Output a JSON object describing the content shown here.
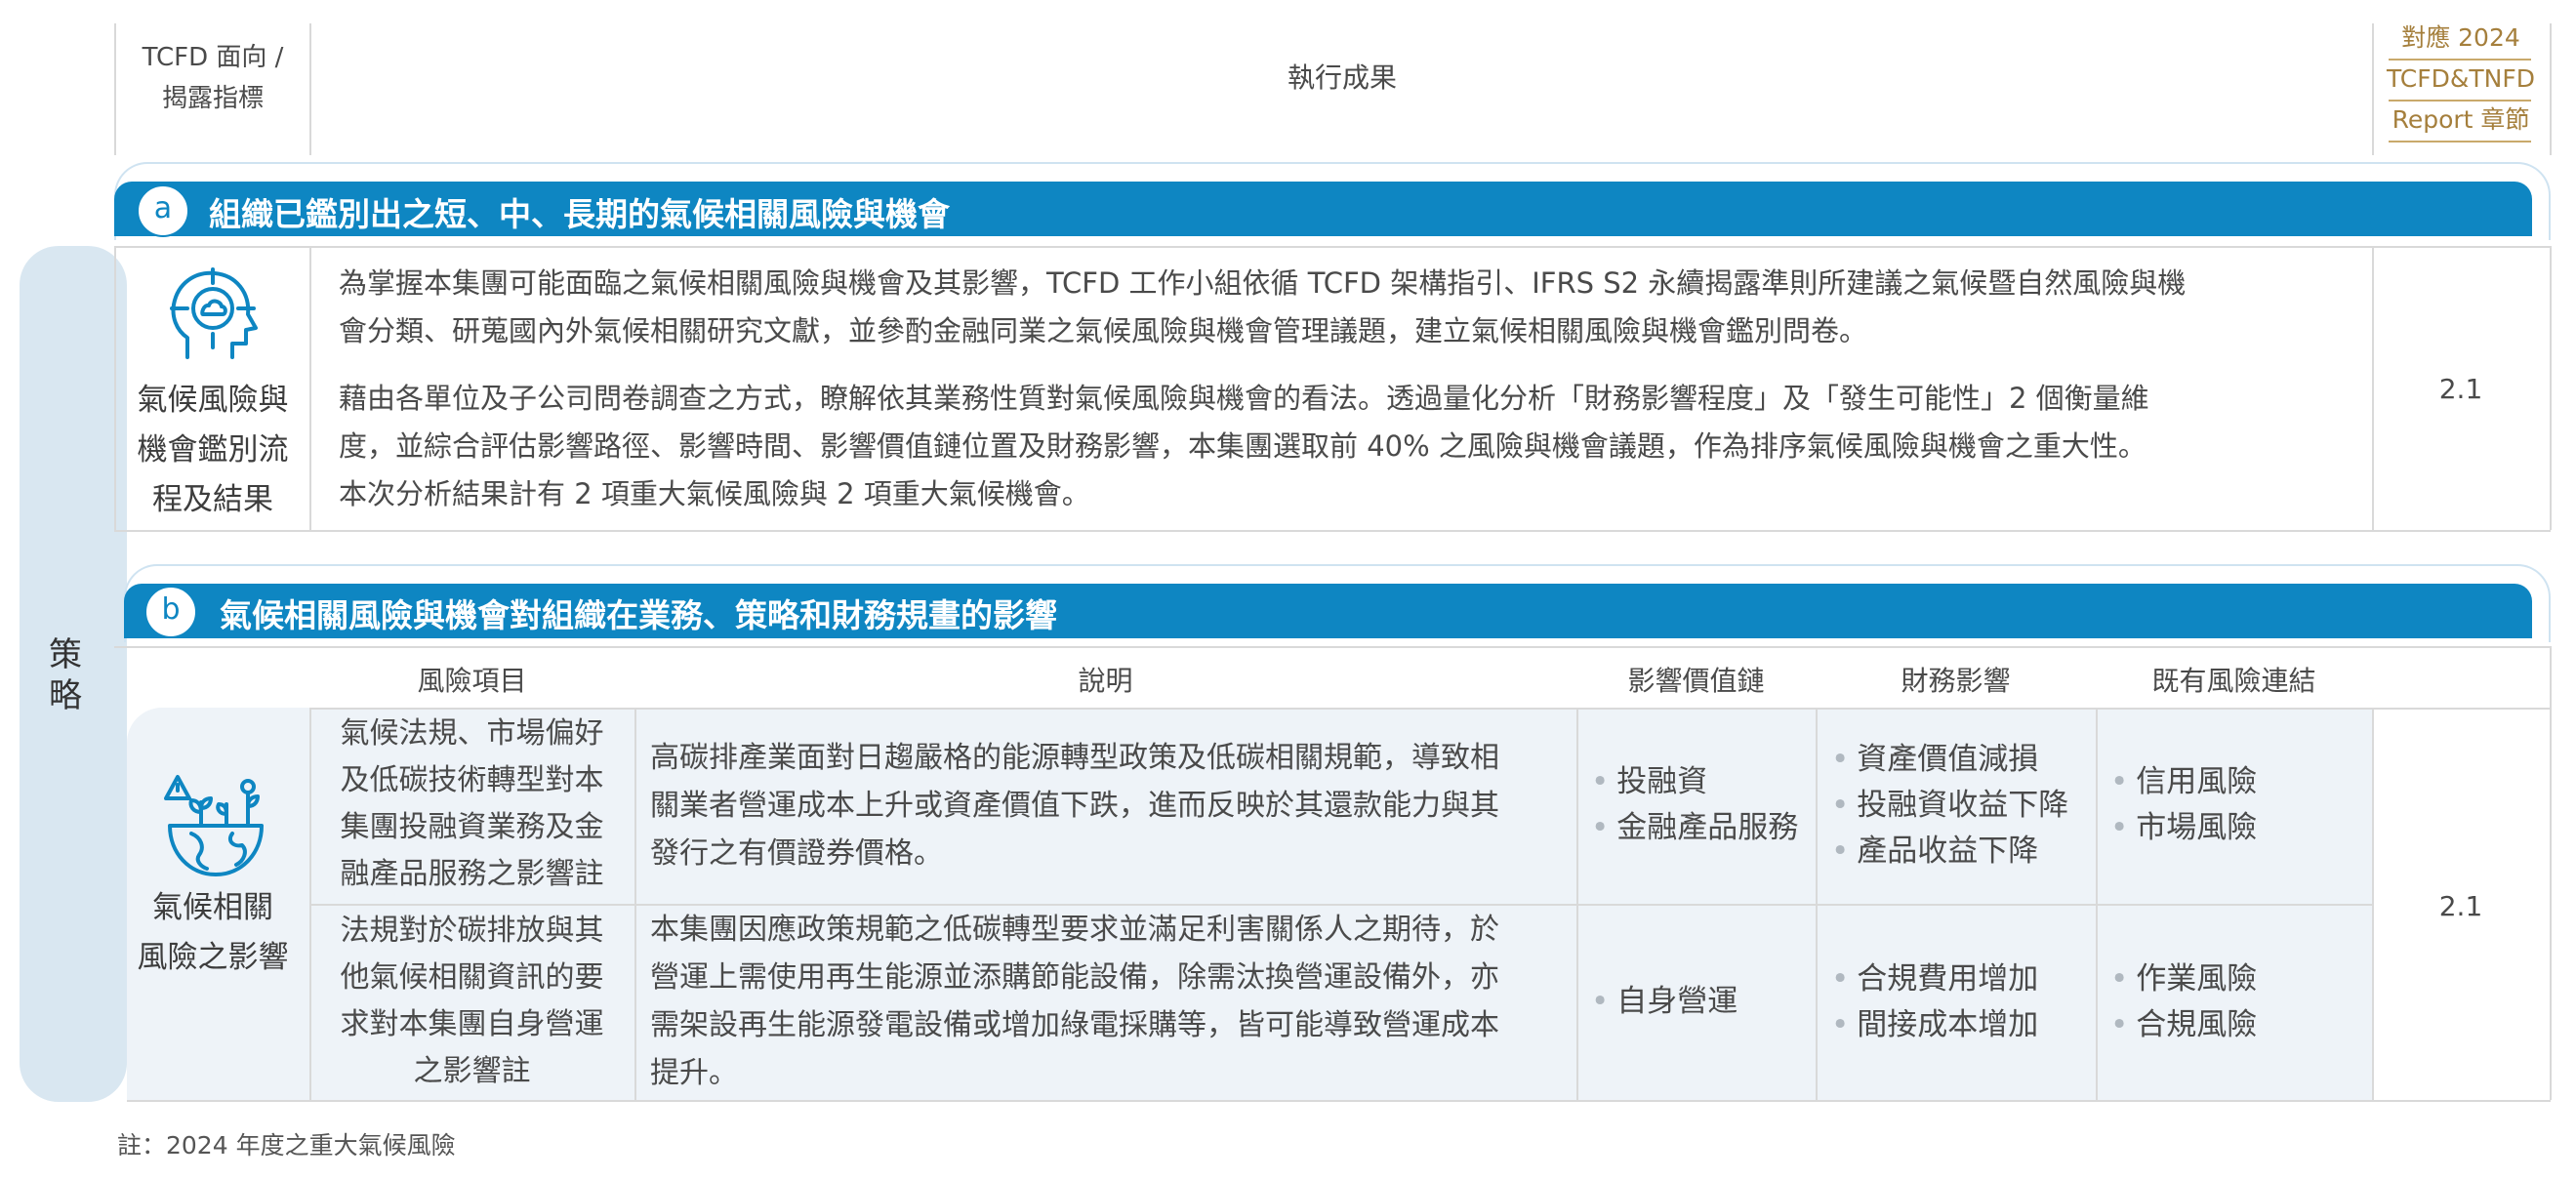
{
  "header": {
    "col1": [
      "TCFD 面向 /",
      "揭露指標"
    ],
    "col2": "執行成果",
    "col3": [
      "對應 2024",
      "TCFD&TNFD",
      "Report 章節"
    ]
  },
  "side_label": "策略",
  "section_a": {
    "badge": "a",
    "title": "組織已鑑別出之短、中、長期的氣候相關風險與機會",
    "category": [
      "氣候風險與",
      "機會鑑別流",
      "程及結果"
    ],
    "icon": "head-target-icon",
    "para1": [
      "為掌握本集團可能面臨之氣候相關風險與機會及其影響，TCFD 工作小組依循 TCFD 架構指引、IFRS S2 永續揭露準則所建議之氣候暨自然風險與機",
      "會分類、研蒐國內外氣候相關研究文獻，並參酌金融同業之氣候風險與機會管理議題，建立氣候相關風險與機會鑑別問卷。"
    ],
    "para2": [
      "藉由各單位及子公司問卷調查之方式，瞭解依其業務性質對氣候風險與機會的看法。透過量化分析「財務影響程度」及「發生可能性」2 個衡量維",
      "度，並綜合評估影響路徑、影響時間、影響價值鏈位置及財務影響，本集團選取前 40% 之風險與機會議題，作為排序氣候風險與機會之重大性。",
      "本次分析結果計有 2 項重大氣候風險與 2 項重大氣候機會。"
    ],
    "chapter": "2.1"
  },
  "section_b": {
    "badge": "b",
    "title": "氣候相關風險與機會對組織在業務、策略和財務規畫的影響",
    "columns": [
      "風險項目",
      "說明",
      "影響價值鏈",
      "財務影響",
      "既有風險連結"
    ],
    "category": [
      "氣候相關",
      "風險之影響"
    ],
    "icon": "warning-plants-globe-icon",
    "chapter": "2.1",
    "rows": [
      {
        "item": [
          "氣候法規、市場偏好",
          "及低碳技術轉型對本",
          "集團投融資業務及金",
          "融產品服務之影響註"
        ],
        "desc": [
          "高碳排產業面對日趨嚴格的能源轉型政策及低碳相關規範，導致相",
          "關業者營運成本上升或資產價值下跌，進而反映於其還款能力與其",
          "發行之有價證券價格。"
        ],
        "value_chain": [
          "投融資",
          "金融產品服務"
        ],
        "financial": [
          "資產價值減損",
          "投融資收益下降",
          "產品收益下降"
        ],
        "risk_link": [
          "信用風險",
          "市場風險"
        ]
      },
      {
        "item": [
          "法規對於碳排放與其",
          "他氣候相關資訊的要",
          "求對本集團自身營運",
          "之影響註"
        ],
        "desc": [
          "本集團因應政策規範之低碳轉型要求並滿足利害關係人之期待，於",
          "營運上需使用再生能源並添購節能設備，除需汰換營運設備外，亦",
          "需架設再生能源發電設備或增加綠電採購等，皆可能導致營運成本",
          "提升。"
        ],
        "value_chain": [
          "自身營運"
        ],
        "financial": [
          "合規費用增加",
          "間接成本增加"
        ],
        "risk_link": [
          "作業風險",
          "合規風險"
        ]
      }
    ]
  },
  "footnote": "註：2024 年度之重大氣候風險",
  "colors": {
    "accent_blue": "#0e86c2",
    "side_panel": "#d9e7f1",
    "row_bg": "#eef3f8",
    "gold": "#a57f3c"
  }
}
